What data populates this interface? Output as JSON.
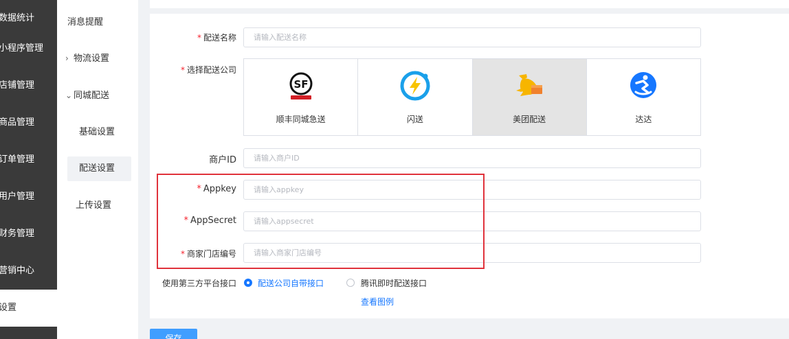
{
  "main_nav": {
    "items": [
      "数据统计",
      "小程序管理",
      "店铺管理",
      "商品管理",
      "订单管理",
      "用户管理",
      "财务管理",
      "营销中心",
      "设置"
    ]
  },
  "sub_nav": {
    "items": [
      "消息提醒",
      "物流设置",
      "同城配送",
      "基础设置",
      "配送设置",
      "上传设置"
    ]
  },
  "form": {
    "delivery_name": {
      "label": "配送名称",
      "placeholder": "请输入配送名称",
      "value": ""
    },
    "company": {
      "label": "选择配送公司",
      "options": [
        "顺丰同城急送",
        "闪送",
        "美团配送",
        "达达"
      ],
      "selected": "美团配送"
    },
    "merchant_id": {
      "label": "商户ID",
      "placeholder": "请输入商户ID",
      "value": ""
    },
    "appkey": {
      "label": "Appkey",
      "placeholder": "请输入appkey",
      "value": ""
    },
    "appsecret": {
      "label": "AppSecret",
      "placeholder": "请输入appsecret",
      "value": ""
    },
    "store_no": {
      "label": "商家门店编号",
      "placeholder": "请输入商家门店编号",
      "value": ""
    },
    "third_party": {
      "label": "使用第三方平台接口",
      "options": [
        "配送公司自带接口",
        "腾讯即时配送接口"
      ],
      "selected": "配送公司自带接口",
      "example_link": "查看图例"
    },
    "save_label": "保存"
  },
  "colors": {
    "accent": "#1677ff",
    "required": "#f5222d",
    "highlight_border": "#e0323b",
    "nav_bg": "#3a3a3a"
  }
}
